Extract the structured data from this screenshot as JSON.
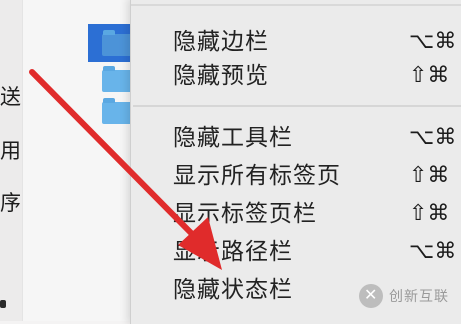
{
  "sidebar": {
    "fragments": [
      "送",
      "用",
      "序"
    ]
  },
  "menu": {
    "group1": [
      {
        "label": "隐藏边栏",
        "shortcut": "⌥⌘"
      },
      {
        "label": "隐藏预览",
        "shortcut": "⇧⌘"
      }
    ],
    "group2": [
      {
        "label": "隐藏工具栏",
        "shortcut": "⌥⌘"
      },
      {
        "label": "显示所有标签页",
        "shortcut": "⇧⌘"
      },
      {
        "label": "显示标签页栏",
        "shortcut": "⇧⌘"
      },
      {
        "label": "显示路径栏",
        "shortcut": "⌥⌘"
      },
      {
        "label": "隐藏状态栏",
        "shortcut": ""
      }
    ]
  },
  "watermark": {
    "text": "创新互联"
  },
  "colors": {
    "selection": "#2c6fd4",
    "arrow": "#e02b2b",
    "folder": "#68b4ea"
  }
}
